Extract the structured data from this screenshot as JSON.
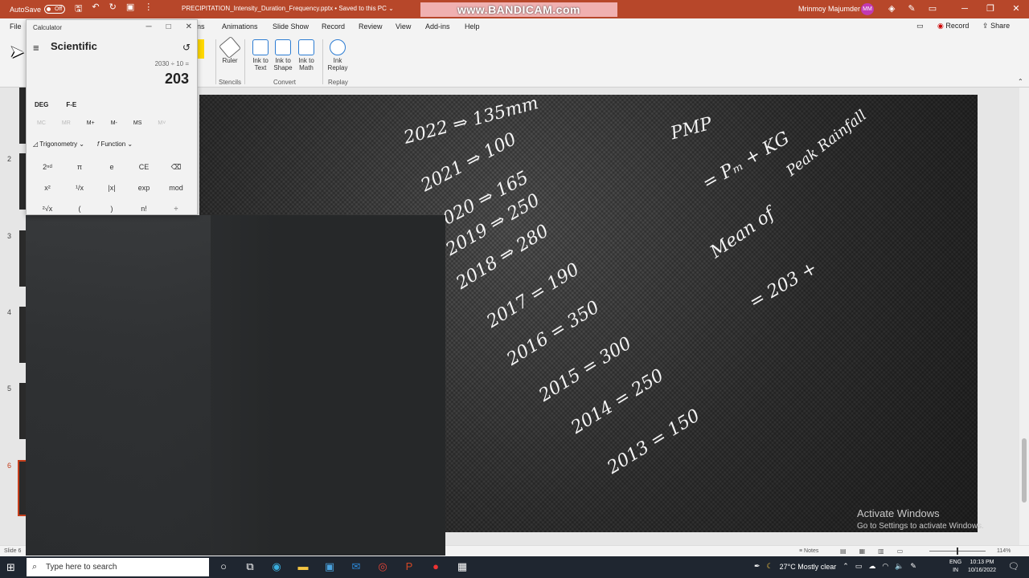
{
  "titlebar": {
    "autosave_label": "AutoSave",
    "autosave_state": "Off",
    "document_title": "PRECIPITATION_Intensity_Duration_Frequency.pptx • Saved to this PC ⌄",
    "watermark": "www.BANDICAM.com",
    "user_name": "Mrinmoy Majumder",
    "user_initials": "MM"
  },
  "ribbon": {
    "tabs": [
      "File",
      "ns",
      "Animations",
      "Slide Show",
      "Record",
      "Review",
      "View",
      "Add-ins",
      "Help"
    ],
    "record_label": "Record",
    "share_label": "Share",
    "items": {
      "ruler": "Ruler",
      "ink_to_text": "Ink to Text",
      "ink_to_shape": "Ink to Shape",
      "ink_to_math": "Ink to Math",
      "ink_replay": "Ink Replay"
    },
    "groups": {
      "stencils": "Stencils",
      "convert": "Convert",
      "replay": "Replay"
    }
  },
  "thumbnails": {
    "numbers": [
      "2",
      "3",
      "4",
      "5",
      "6"
    ],
    "active": "6"
  },
  "calculator": {
    "window_title": "Calculator",
    "mode": "Scientific",
    "expression": "2030 ÷ 10 =",
    "result": "203",
    "angle_mode": "DEG",
    "fe_label": "F-E",
    "memory": [
      "MC",
      "MR",
      "M+",
      "M-",
      "MS",
      "M˅"
    ],
    "trig_label": "Trigonometry",
    "function_label": "Function",
    "keys": [
      "2ⁿᵈ",
      "π",
      "e",
      "CE",
      "⌫",
      "x²",
      "¹/x",
      "|x|",
      "exp",
      "mod",
      "²√x",
      "(",
      ")",
      "n!",
      "÷"
    ]
  },
  "slide": {
    "handwriting_left": [
      "2022 ⇒ 135mm",
      "2021 ⇒ 100",
      "2020 ⇒ 165",
      "2019 ⇒ 250",
      "2018 ⇒ 280",
      "2017 = 190",
      "2016 = 350",
      "2015 = 300",
      "2014 = 250",
      "2013 = 150"
    ],
    "handwriting_right": [
      "PMP",
      "= Pₘ + KG",
      "Peak Rainfall",
      "Mean of",
      "= 203 +"
    ]
  },
  "watermark": {
    "line1": "Activate Windows",
    "line2": "Go to Settings to activate Windows."
  },
  "statusbar": {
    "slide_info": "Slide 6",
    "notes_label": "Notes",
    "zoom": "114%"
  },
  "taskbar": {
    "search_placeholder": "Type here to search",
    "weather": "27°C  Mostly clear",
    "lang": "ENG",
    "region": "IN",
    "time": "10:13 PM",
    "date": "10/16/2022"
  }
}
